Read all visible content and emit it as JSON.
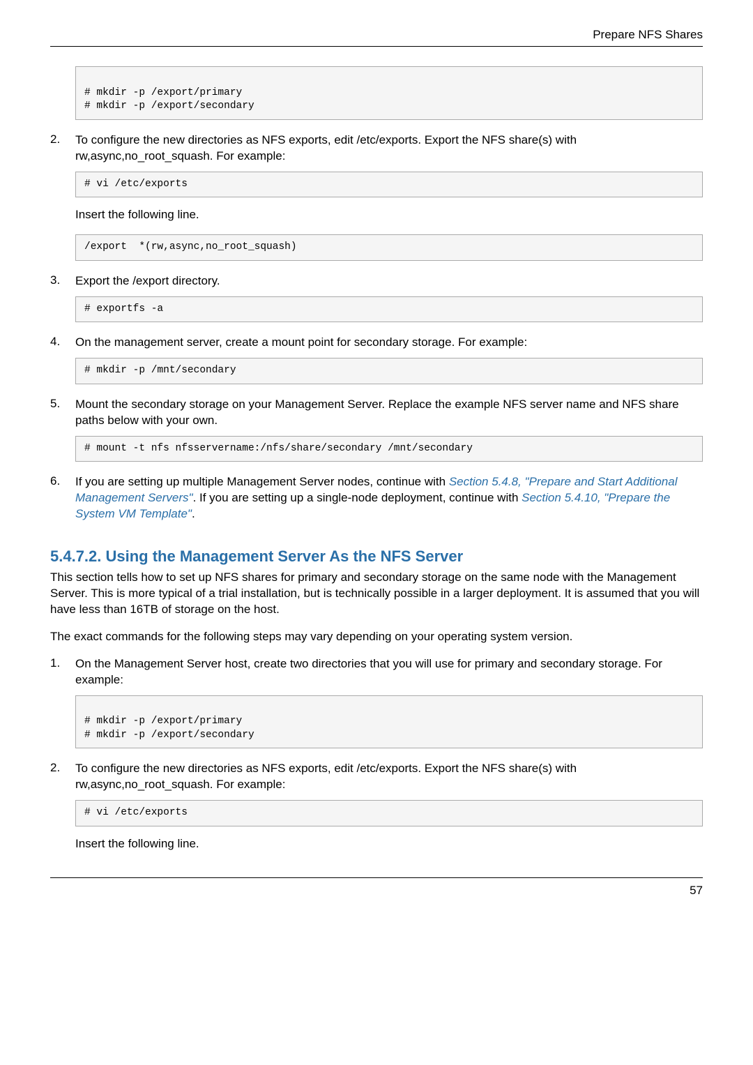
{
  "running_title": "Prepare NFS Shares",
  "code_block_1": "\n# mkdir -p /export/primary\n# mkdir -p /export/secondary\n",
  "step2_text": "To configure the new directories as NFS exports, edit /etc/exports. Export the NFS share(s) with rw,async,no_root_squash. For example:",
  "code_block_2": "# vi /etc/exports",
  "step2_after": "Insert the following line.",
  "code_block_3": "/export  *(rw,async,no_root_squash)",
  "step3_text": "Export the /export directory.",
  "code_block_4": "# exportfs -a",
  "step4_text": "On the management server, create a mount point for secondary storage. For example:",
  "code_block_5": "# mkdir -p /mnt/secondary",
  "step5_text": "Mount the secondary storage on your Management Server. Replace the example NFS server name and NFS share paths below with your own.",
  "code_block_6": "# mount -t nfs nfsservername:/nfs/share/secondary /mnt/secondary",
  "step6_prefix": "If you are setting up multiple Management Server nodes, continue with ",
  "step6_link1": "Section 5.4.8, \"Prepare and Start Additional Management Servers\"",
  "step6_mid": ". If you are setting up a single-node deployment, continue with ",
  "step6_link2": "Section 5.4.10, \"Prepare the System VM Template\"",
  "step6_suffix": ".",
  "section_heading": "5.4.7.2. Using the Management Server As the NFS Server",
  "section_para1": "This section tells how to set up NFS shares for primary and secondary storage on the same node with the Management Server. This is more typical of a trial installation, but is technically possible in a larger deployment. It is assumed that you will have less than 16TB of storage on the host.",
  "section_para2": "The exact commands for the following steps may vary depending on your operating system version.",
  "sec_step1_text": "On the Management Server host, create two directories that you will use for primary and secondary storage. For example:",
  "code_block_7": "\n# mkdir -p /export/primary\n# mkdir -p /export/secondary\n",
  "sec_step2_text": "To configure the new directories as NFS exports, edit /etc/exports. Export the NFS share(s) with rw,async,no_root_squash. For example:",
  "code_block_8": "# vi /etc/exports",
  "sec_step2_after": "Insert the following line.",
  "page_number": "57",
  "list_numbers": {
    "n2": "2.",
    "n3": "3.",
    "n4": "4.",
    "n5": "5.",
    "n6": "6.",
    "s1": "1.",
    "s2": "2."
  }
}
